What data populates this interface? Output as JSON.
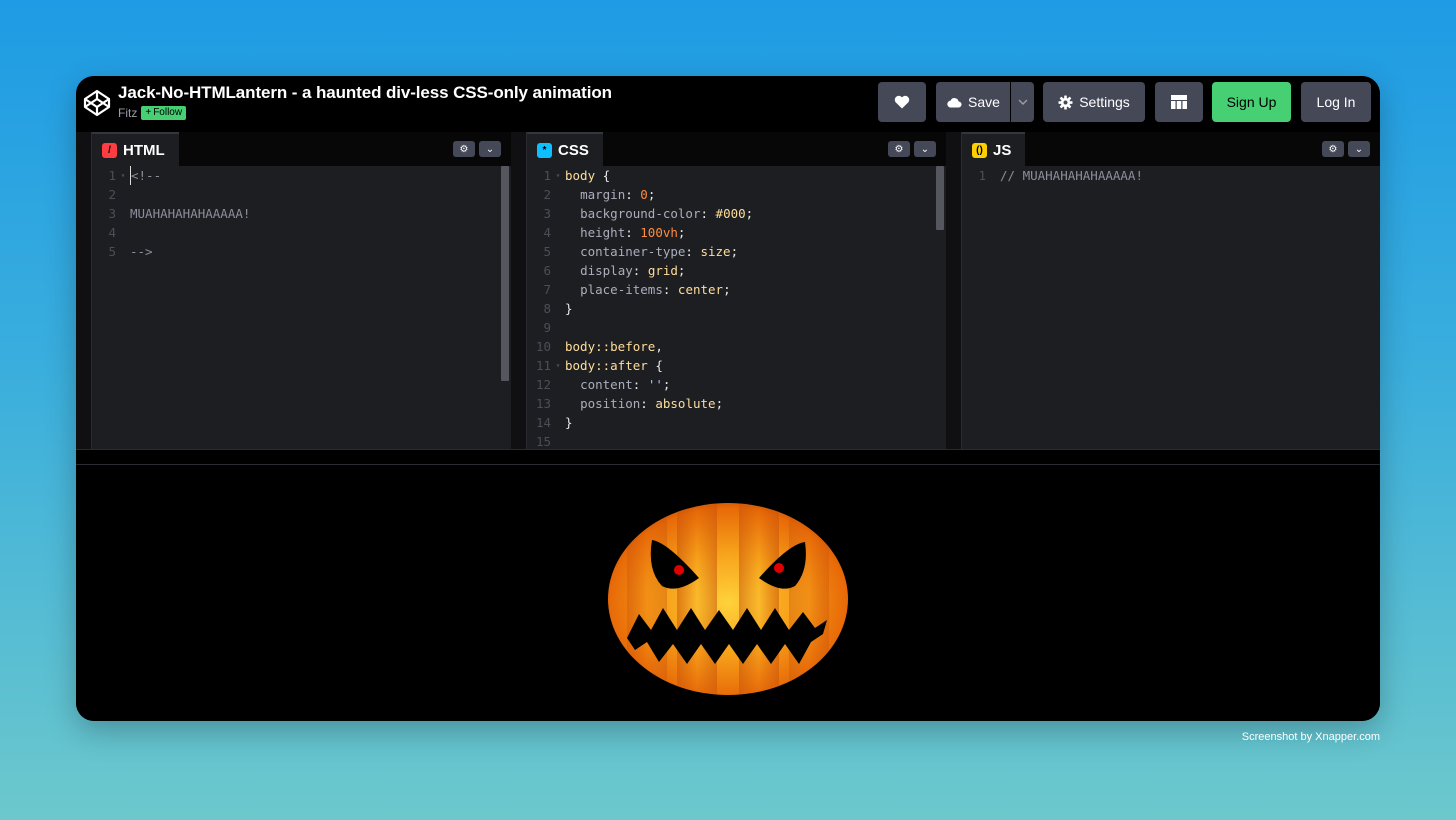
{
  "pen": {
    "title": "Jack-No-HTMLantern - a haunted div-less CSS-only animation",
    "author": "Fitz",
    "follow_label": "Follow"
  },
  "header_buttons": {
    "save_label": "Save",
    "settings_label": "Settings",
    "signup_label": "Sign Up",
    "login_label": "Log In"
  },
  "editors": {
    "html": {
      "tab_label": "HTML",
      "icon_color": "#ff3c41",
      "lines": [
        "<!--",
        "",
        "MUAHAHAHAHAAAAA!",
        "",
        "-->"
      ]
    },
    "css": {
      "tab_label": "CSS",
      "icon_color": "#0ebeff",
      "lines": [
        "body {",
        "  margin: 0;",
        "  background-color: #000;",
        "  height: 100vh;",
        "  container-type: size;",
        "  display: grid;",
        "  place-items: center;",
        "}",
        "",
        "body::before,",
        "body::after {",
        "  content: '';",
        "  position: absolute;",
        "}",
        ""
      ]
    },
    "js": {
      "tab_label": "JS",
      "icon_color": "#fcd000",
      "lines": [
        "// MUAHAHAHAHAAAAA!"
      ]
    }
  },
  "icons": {
    "logo": "codepen-cube-icon",
    "heart": "heart-icon",
    "save": "cloud-icon",
    "settings": "gear-icon",
    "layout": "layout-grid-icon"
  },
  "colors": {
    "accent_green": "#47cf73",
    "button_gray": "#444857",
    "pumpkin_orange": "#f7a21b",
    "eye_red": "#e00000"
  },
  "watermark": "Screenshot by Xnapper.com"
}
